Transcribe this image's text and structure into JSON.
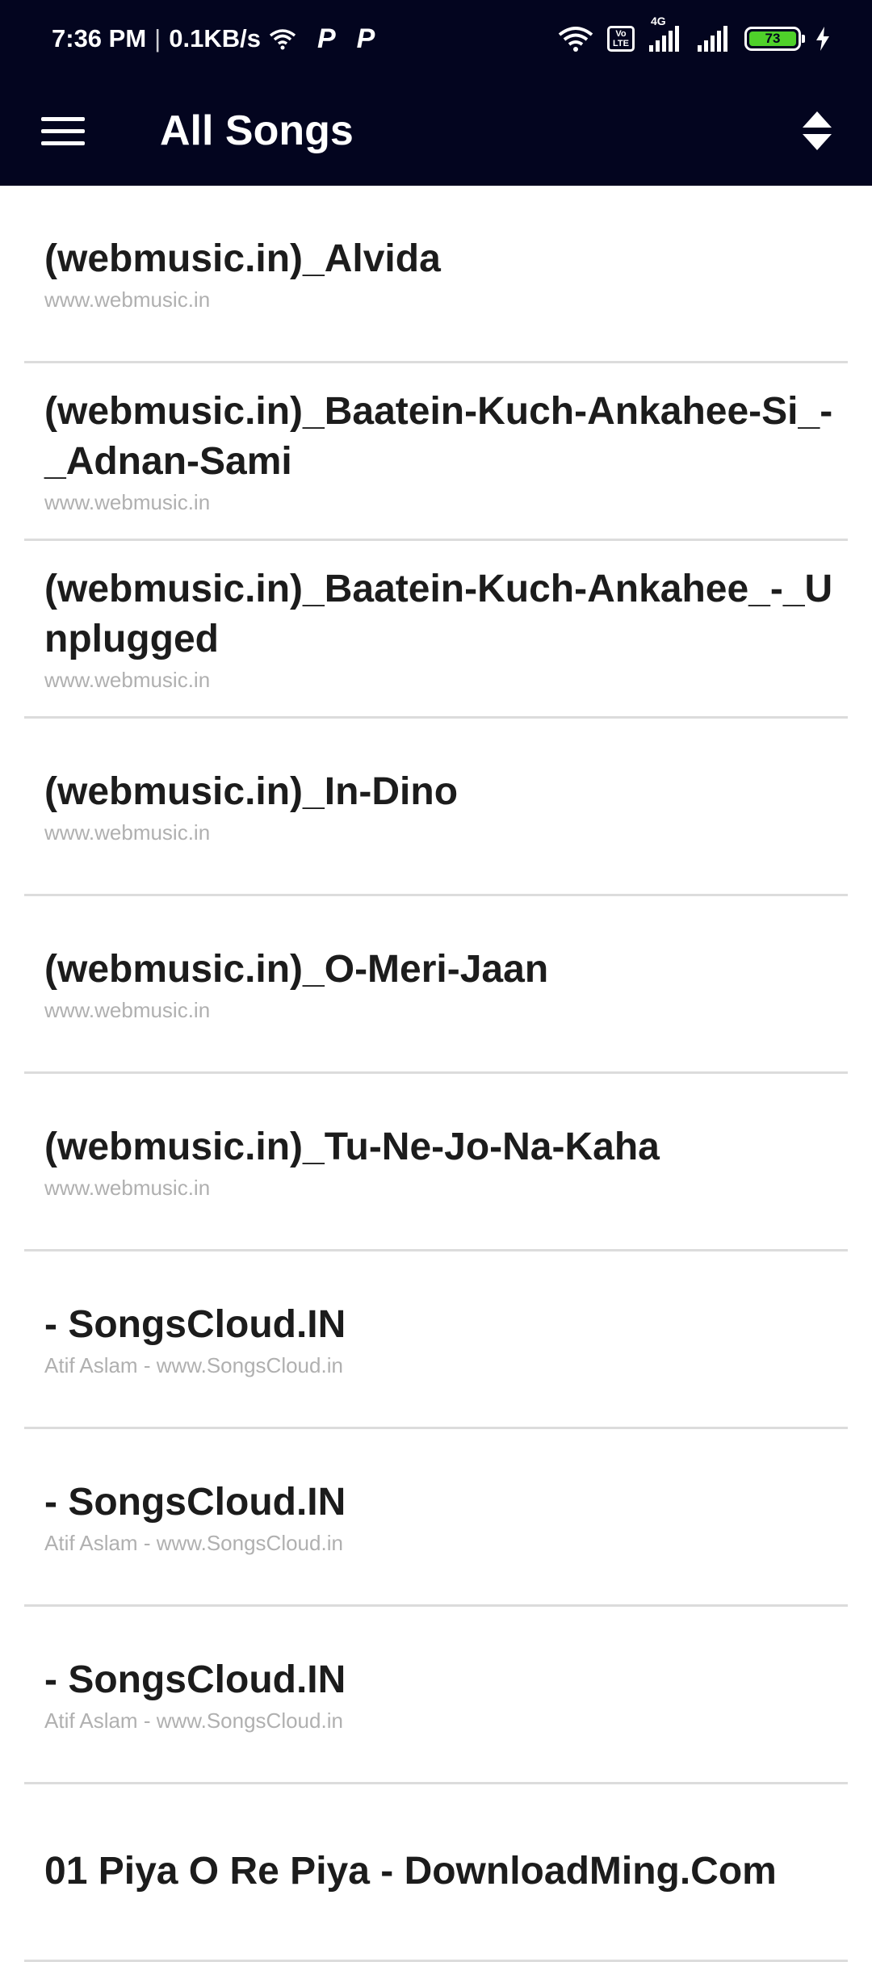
{
  "status_bar": {
    "time": "7:36 PM",
    "speed": "0.1KB/s",
    "battery": "73",
    "network": "4G",
    "volte": "Vo LTE",
    "icons": [
      "wifi-icon",
      "p-icon",
      "p-icon",
      "volte-icon",
      "signal-icon",
      "signal-icon",
      "battery-icon",
      "charging-icon"
    ]
  },
  "toolbar": {
    "title": "All Songs",
    "menu_icon": "hamburger-menu-icon",
    "sort_icon": "sort-icon"
  },
  "colors": {
    "header_bg": "#03051f",
    "title_text": "#1c1c1c",
    "subtitle_text": "#b0b0b0",
    "divider": "#dcdcdc",
    "battery": "#4fd12a"
  },
  "songs": [
    {
      "title": "(webmusic.in)_Alvida",
      "subtitle": "www.webmusic.in"
    },
    {
      "title": "(webmusic.in)_Baatein-Kuch-Ankahee-Si_-_Adnan-Sami",
      "subtitle": "www.webmusic.in"
    },
    {
      "title": "(webmusic.in)_Baatein-Kuch-Ankahee_-_Unplugged",
      "subtitle": "www.webmusic.in"
    },
    {
      "title": "(webmusic.in)_In-Dino",
      "subtitle": "www.webmusic.in"
    },
    {
      "title": "(webmusic.in)_O-Meri-Jaan",
      "subtitle": "www.webmusic.in"
    },
    {
      "title": "(webmusic.in)_Tu-Ne-Jo-Na-Kaha",
      "subtitle": "www.webmusic.in"
    },
    {
      "title": "- SongsCloud.IN",
      "subtitle": "Atif Aslam - www.SongsCloud.in"
    },
    {
      "title": "- SongsCloud.IN",
      "subtitle": "Atif Aslam - www.SongsCloud.in"
    },
    {
      "title": "- SongsCloud.IN",
      "subtitle": "Atif Aslam - www.SongsCloud.in"
    },
    {
      "title": "01 Piya O Re Piya - DownloadMing.Com",
      "subtitle": ""
    }
  ]
}
